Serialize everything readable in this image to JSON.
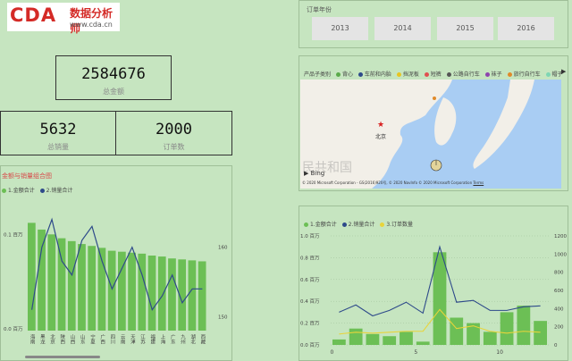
{
  "logo": {
    "mark": "CDA",
    "name_cn": "数据分析师",
    "url": "www.cda.cn"
  },
  "kpis": [
    {
      "value": "2584676",
      "label": "总金额"
    },
    {
      "value": "5632",
      "label": "总销量"
    },
    {
      "value": "2000",
      "label": "订单数"
    }
  ],
  "slicer": {
    "title": "订单年份",
    "years": [
      "2013",
      "2014",
      "2015",
      "2016"
    ]
  },
  "map": {
    "legend_title": "产品子类别",
    "legend": [
      {
        "name": "背心",
        "color": "#5aaa4a"
      },
      {
        "name": "车前和内胎",
        "color": "#2e4a8a"
      },
      {
        "name": "挡泥板",
        "color": "#e8c520"
      },
      {
        "name": "短裤",
        "color": "#e05050"
      },
      {
        "name": "公路自行车",
        "color": "#555555"
      },
      {
        "name": "袜子",
        "color": "#8e44ad"
      },
      {
        "name": "旅行自行车",
        "color": "#e08a2a"
      },
      {
        "name": "帽子",
        "color": "#7ed6b4"
      }
    ],
    "city": "北京",
    "watermark": "民共和国",
    "bing": "Bing",
    "copyright": "© 2020 Microsoft Corporation - GS(2016)920号, © 2020 NavInfo  © 2020 Microsoft Corporation",
    "terms": "Terms"
  },
  "chart_data": [
    {
      "type": "bar",
      "title": "金额与销量组合图",
      "legend": [
        "1.金额合计",
        "2.销量合计"
      ],
      "categories": [
        "海南",
        "黑龙",
        "北京",
        "陕西",
        "山西",
        "山东",
        "宁夏",
        "广西",
        "四川",
        "云南",
        "天津",
        "江苏",
        "福建",
        "上海",
        "广东",
        "九州",
        "湖北",
        "西藏"
      ],
      "series": [
        {
          "name": "1.金额合计",
          "type": "bar",
          "axis": "left",
          "values": [
            0.112,
            0.105,
            0.1,
            0.096,
            0.093,
            0.09,
            0.088,
            0.086,
            0.083,
            0.082,
            0.081,
            0.08,
            0.078,
            0.077,
            0.075,
            0.074,
            0.073,
            0.072
          ]
        },
        {
          "name": "2.销量合计",
          "type": "line",
          "axis": "right",
          "values": [
            151,
            160,
            164,
            158,
            156,
            161,
            163,
            158,
            154,
            157,
            160,
            156,
            151,
            153,
            156,
            152,
            154,
            154
          ]
        }
      ],
      "y_left_ticks": [
        "0.1 百万",
        "0.0 百万"
      ],
      "y_right_ticks": [
        "160",
        "150"
      ],
      "ylim": [
        0,
        0.13
      ],
      "y2lim": [
        148,
        166
      ]
    },
    {
      "type": "bar",
      "title": "",
      "legend": [
        "1.金额合计",
        "2.销量合计",
        "3.订单数量"
      ],
      "x": [
        0,
        1,
        2,
        3,
        4,
        5,
        6,
        7,
        8,
        9,
        10,
        11,
        12
      ],
      "series": [
        {
          "name": "1.金额合计",
          "type": "bar",
          "axis": "left",
          "values": [
            0.05,
            0.15,
            0.1,
            0.08,
            0.12,
            0.03,
            0.85,
            0.25,
            0.2,
            0.12,
            0.3,
            0.36,
            0.22
          ]
        },
        {
          "name": "2.销量合计",
          "type": "line",
          "axis": "right",
          "values": [
            360,
            440,
            320,
            380,
            470,
            350,
            1080,
            470,
            490,
            380,
            380,
            420,
            430
          ]
        },
        {
          "name": "3.订单数量",
          "type": "line",
          "axis": "right",
          "values": [
            120,
            140,
            130,
            140,
            150,
            150,
            390,
            180,
            210,
            150,
            130,
            150,
            140
          ]
        }
      ],
      "y_left_ticks": [
        "1.0 百万",
        "0.8 百万",
        "0.6 百万",
        "0.4 百万",
        "0.2 百万",
        "0.0 百万"
      ],
      "y_right_ticks": [
        "1200",
        "1000",
        "800",
        "600",
        "400",
        "200",
        "0"
      ],
      "x_ticks": [
        "0",
        "5",
        "10"
      ],
      "ylim": [
        0,
        1.0
      ],
      "y2lim": [
        0,
        1200
      ]
    }
  ],
  "colors": {
    "bar": "#6cbf55",
    "line1": "#2e4a8a",
    "line2": "#e8d43a",
    "bg": "#c6e5c0"
  }
}
